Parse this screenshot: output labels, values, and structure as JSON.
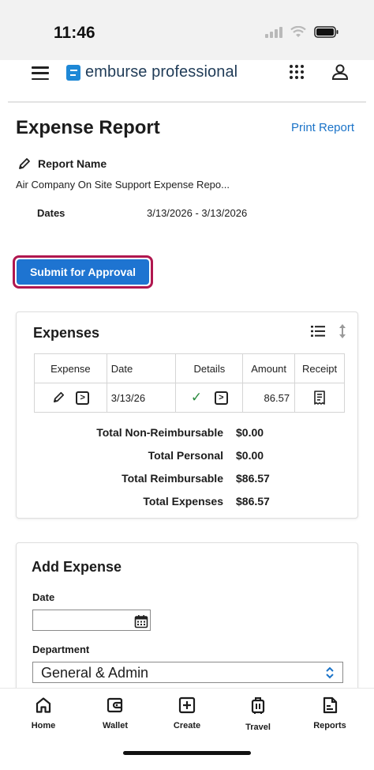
{
  "status_bar": {
    "time": "11:46"
  },
  "header": {
    "brand": "emburse professional"
  },
  "page": {
    "title": "Expense Report",
    "print_link": "Print Report",
    "report_name_label": "Report Name",
    "report_name_value": "Air Company On Site Support Expense Repo...",
    "dates_label": "Dates",
    "dates_value": "3/13/2026 - 3/13/2026",
    "submit_label": "Submit for Approval"
  },
  "expenses": {
    "title": "Expenses",
    "columns": [
      "Expense",
      "Date",
      "Details",
      "Amount",
      "Receipt"
    ],
    "rows": [
      {
        "date": "3/13/26",
        "amount": "86.57"
      }
    ],
    "totals": [
      {
        "label": "Total Non-Reimbursable",
        "value": "$0.00"
      },
      {
        "label": "Total Personal",
        "value": "$0.00"
      },
      {
        "label": "Total Reimbursable",
        "value": "$86.57"
      },
      {
        "label": "Total Expenses",
        "value": "$86.57"
      }
    ]
  },
  "add_expense": {
    "title": "Add Expense",
    "date_label": "Date",
    "date_value": "",
    "department_label": "Department",
    "department_value": "General & Admin"
  },
  "bottom_nav": [
    {
      "label": "Home",
      "icon": "home-icon"
    },
    {
      "label": "Wallet",
      "icon": "wallet-icon"
    },
    {
      "label": "Create",
      "icon": "plus-square-icon"
    },
    {
      "label": "Travel",
      "icon": "luggage-icon"
    },
    {
      "label": "Reports",
      "icon": "report-icon"
    }
  ],
  "colors": {
    "accent": "#1e74d1",
    "link": "#1a73c8",
    "highlight": "#b0174f",
    "check": "#2a8a3e"
  }
}
